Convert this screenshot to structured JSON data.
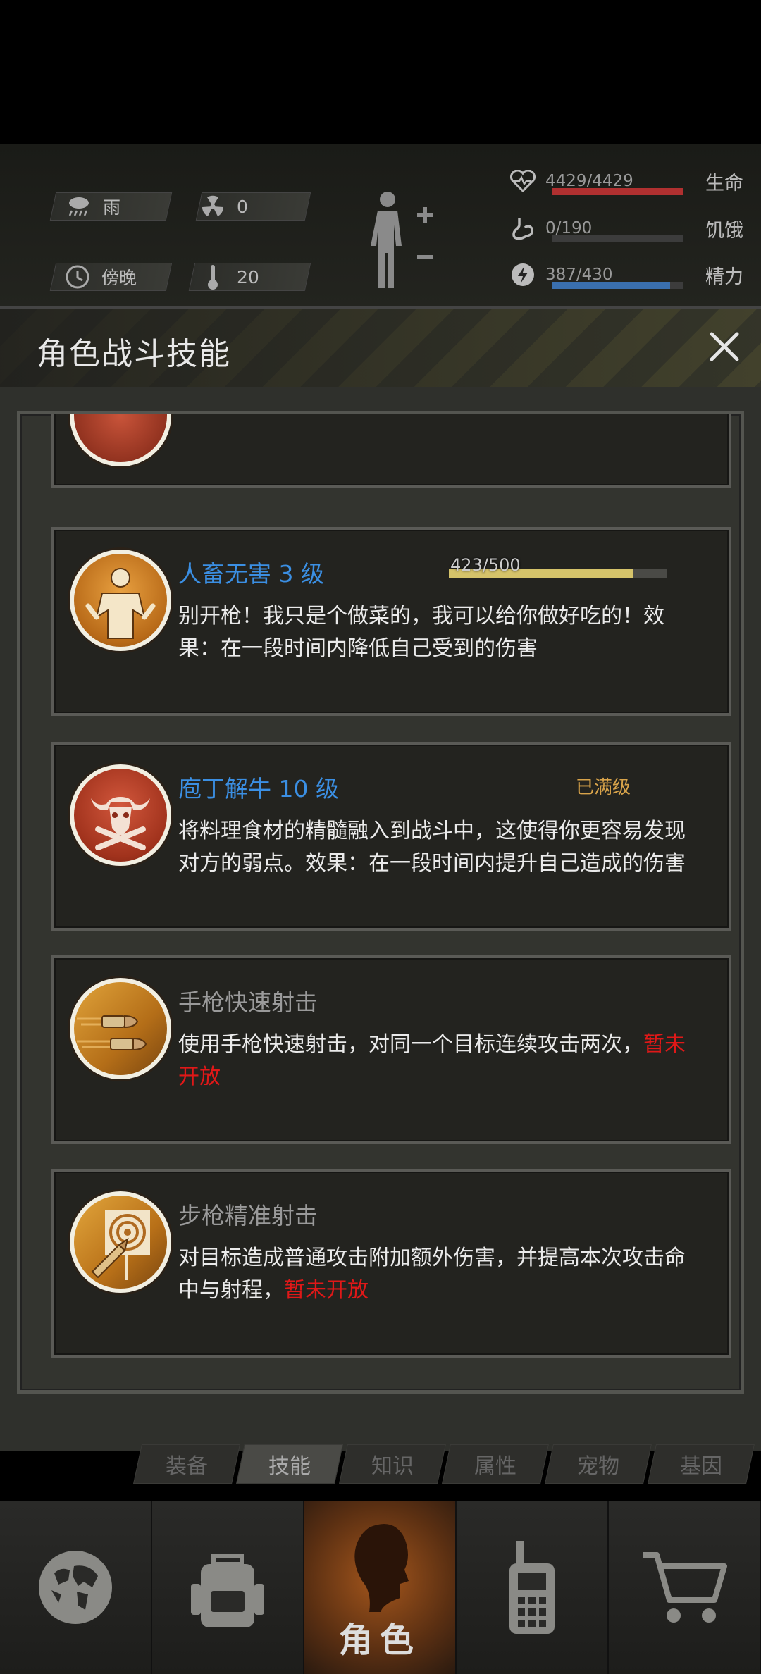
{
  "hud": {
    "weather": "雨",
    "radiation": "0",
    "time_of_day": "傍晚",
    "temperature": "20",
    "stats": [
      {
        "icon": "heart-icon",
        "value": "4429/4429",
        "label": "生命",
        "fill": 1.0,
        "color": "#b03030"
      },
      {
        "icon": "stomach-icon",
        "value": "0/190",
        "label": "饥饿",
        "fill": 0.0,
        "color": "#888888"
      },
      {
        "icon": "energy-icon",
        "value": "387/430",
        "label": "精力",
        "fill": 0.9,
        "color": "#3a6fae"
      }
    ]
  },
  "dialog": {
    "title": "角色战斗技能",
    "skills": [
      {
        "name": "人畜无害 3 级",
        "icon": "cook-shrug-icon",
        "xp_text": "423/500",
        "xp_fill": 0.846,
        "desc": "别开枪！我只是个做菜的，我可以给你做好吃的！效果：在一段时间内降低自己受到的伤害"
      },
      {
        "name": "庖丁解牛 10 级",
        "icon": "bull-skull-knives-icon",
        "status": "已满级",
        "desc": "将料理食材的精髓融入到战斗中，这使得你更容易发现对方的弱点。效果：在一段时间内提升自己造成的伤害"
      },
      {
        "name": "手枪快速射击",
        "icon": "bullets-icon",
        "desc": "使用手枪快速射击，对同一个目标连续攻击两次，",
        "locked": "暂未开放"
      },
      {
        "name": "步枪精准射击",
        "icon": "target-bullet-icon",
        "desc": "对目标造成普通攻击附加额外伤害，并提高本次攻击命中与射程，",
        "locked": "暂未开放"
      }
    ]
  },
  "subtabs": [
    "装备",
    "技能",
    "知识",
    "属性",
    "宠物",
    "基因"
  ],
  "bottom_nav": {
    "selected_label": "角色"
  }
}
